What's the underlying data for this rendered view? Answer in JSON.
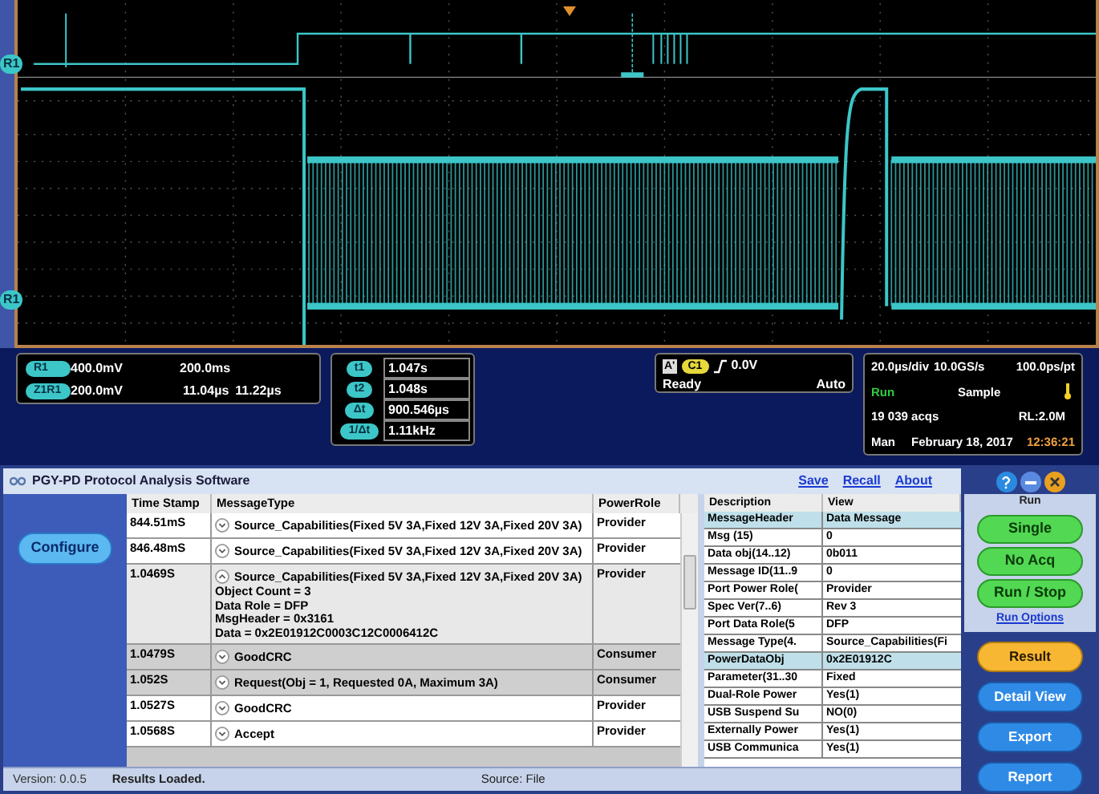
{
  "scope": {
    "markers": [
      "R1",
      "R1"
    ]
  },
  "readouts": {
    "channel": {
      "badge": "R1",
      "scale": "400.0mV",
      "time": "200.0ms"
    },
    "zoom": {
      "badge": "Z1R1",
      "scale": "200.0mV",
      "start": "11.04µs",
      "end": "11.22µs"
    }
  },
  "cursors": [
    {
      "badge": "t1",
      "value": "1.047s"
    },
    {
      "badge": "t2",
      "value": "1.048s"
    },
    {
      "badge": "Δt",
      "value": "900.546µs"
    },
    {
      "badge": "1/Δt",
      "value": "1.11kHz"
    }
  ],
  "trigger": {
    "type_badge": "A'",
    "source": "C1",
    "level": "0.0V",
    "state": "Ready",
    "mode": "Auto"
  },
  "acquisition": {
    "horizontal": "20.0µs/div",
    "rate": "10.0GS/s",
    "resolution": "100.0ps/pt",
    "run_state": "Run",
    "mode": "Sample",
    "acqs": "19 039 acqs",
    "record": "RL:2.0M",
    "trigger_mode": "Man",
    "date": "February 18, 2017",
    "time": "12:36:21"
  },
  "app": {
    "title": "PGY-PD Protocol Analysis Software",
    "links": [
      "Save",
      "Recall",
      "About"
    ],
    "configure": "Configure",
    "table": {
      "columns": [
        "Time Stamp",
        "MessageType",
        "PowerRole"
      ],
      "rows": [
        {
          "time": "844.51mS",
          "message": "Source_Capabilities(Fixed 5V 3A,Fixed 12V 3A,Fixed 20V 3A)",
          "role": "Provider",
          "expanded": false,
          "selected": false
        },
        {
          "time": "846.48mS",
          "message": "Source_Capabilities(Fixed 5V 3A,Fixed 12V 3A,Fixed 20V 3A)",
          "role": "Provider",
          "expanded": false,
          "selected": false
        },
        {
          "time": "1.0469S",
          "message": "Source_Capabilities(Fixed 5V 3A,Fixed 12V 3A,Fixed 20V 3A)",
          "role": "Provider",
          "expanded": true,
          "selected": false,
          "details": [
            "Object Count = 3",
            "Data Role = DFP",
            "MsgHeader = 0x3161",
            "Data = 0x2E01912C0003C12C0006412C"
          ]
        },
        {
          "time": "1.0479S",
          "message": "GoodCRC",
          "role": "Consumer",
          "expanded": false,
          "selected": true
        },
        {
          "time": "1.052S",
          "message": "Request(Obj = 1, Requested 0A, Maximum 3A)",
          "role": "Consumer",
          "expanded": false,
          "selected": true
        },
        {
          "time": "1.0527S",
          "message": "GoodCRC",
          "role": "Provider",
          "expanded": false,
          "selected": false
        },
        {
          "time": "1.0568S",
          "message": "Accept",
          "role": "Provider",
          "expanded": false,
          "selected": false
        }
      ]
    },
    "detail": {
      "columns": [
        "Description",
        "View"
      ],
      "rows": [
        {
          "kind": "section",
          "description": "MessageHeader",
          "view": "Data Message"
        },
        {
          "kind": "field",
          "description": "Msg (15)",
          "view": "0"
        },
        {
          "kind": "field",
          "description": "Data obj(14..12)",
          "view": "0b011"
        },
        {
          "kind": "field",
          "description": "Message ID(11..9",
          "view": "0"
        },
        {
          "kind": "field",
          "description": "Port Power Role(",
          "view": "Provider"
        },
        {
          "kind": "field",
          "description": "Spec Ver(7..6)",
          "view": "Rev 3"
        },
        {
          "kind": "field",
          "description": "Port Data Role(5",
          "view": "DFP"
        },
        {
          "kind": "field",
          "description": "Message Type(4.",
          "view": "Source_Capabilities(Fi"
        },
        {
          "kind": "section",
          "description": "PowerDataObj",
          "view": "0x2E01912C"
        },
        {
          "kind": "field",
          "description": "Parameter(31..30",
          "view": "Fixed"
        },
        {
          "kind": "field",
          "description": "Dual-Role Power",
          "view": "Yes(1)"
        },
        {
          "kind": "field",
          "description": "USB Suspend Su",
          "view": "NO(0)"
        },
        {
          "kind": "field",
          "description": "Externally Power",
          "view": "Yes(1)"
        },
        {
          "kind": "field",
          "description": "USB Communica",
          "view": "Yes(1)"
        }
      ]
    },
    "run_label": "Run",
    "run_buttons": [
      "Single",
      "No Acq",
      "Run / Stop"
    ],
    "run_options": "Run Options",
    "nav": [
      {
        "label": "Result",
        "selected": true
      },
      {
        "label": "Detail View",
        "selected": false
      },
      {
        "label": "Export",
        "selected": false
      },
      {
        "label": "Report",
        "selected": false
      }
    ],
    "status": {
      "version": "Version: 0.0.5",
      "message": "Results Loaded.",
      "source": "Source: File"
    }
  }
}
